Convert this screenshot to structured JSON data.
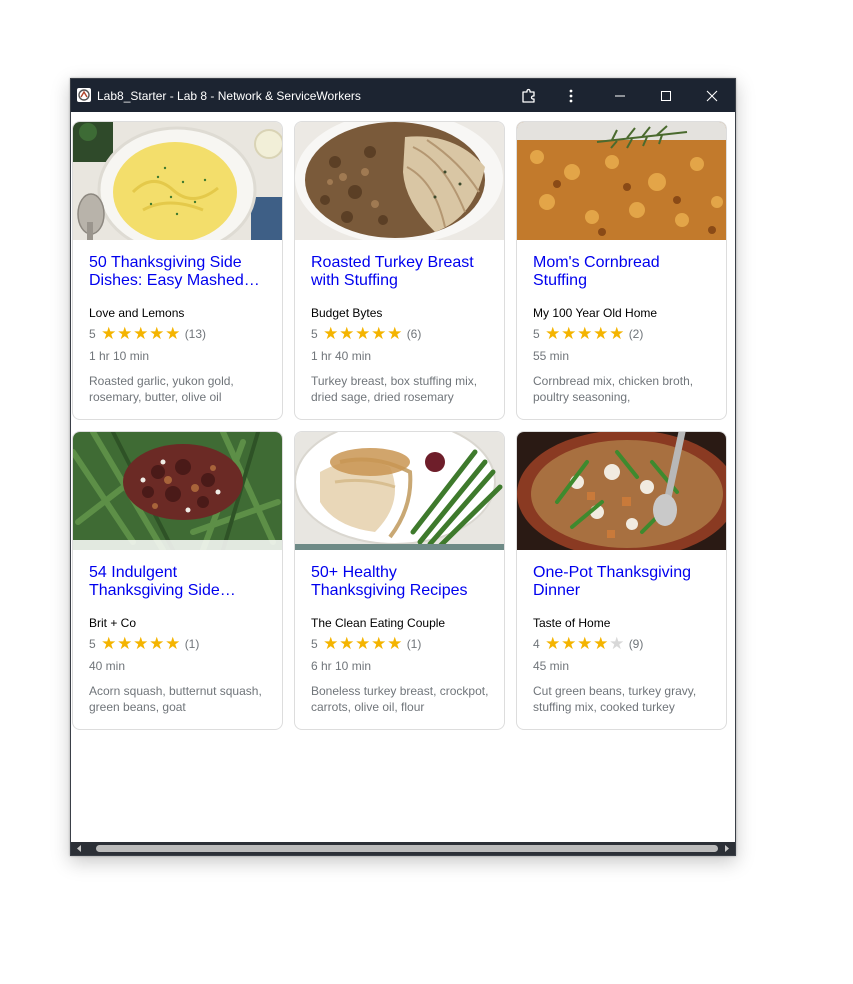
{
  "window": {
    "title": "Lab8_Starter - Lab 8 - Network & ServiceWorkers",
    "controls": {
      "extension_icon": "puzzle-icon",
      "menu_icon": "kebab-menu-icon",
      "minimize_icon": "minimize-icon",
      "maximize_icon": "maximize-icon",
      "close_icon": "close-icon"
    },
    "titlebar_color": "#1c2431"
  },
  "recipes": [
    {
      "title_line1": "50 Thanksgiving Side",
      "title_line2": "Dishes: Easy Mashed…",
      "author": "Love and Lemons",
      "rating": "5",
      "stars": 5,
      "reviews": "(13)",
      "time": "1 hr 10 min",
      "ingredients": "Roasted garlic, yukon gold, rosemary, butter, olive oil",
      "image": "mashed-potatoes"
    },
    {
      "title_line1": "Roasted Turkey Breast",
      "title_line2": "with Stuffing",
      "author": "Budget Bytes",
      "rating": "5",
      "stars": 5,
      "reviews": "(6)",
      "time": "1 hr 40 min",
      "ingredients": "Turkey breast, box stuffing mix, dried sage, dried rosemary",
      "image": "turkey-stuffing"
    },
    {
      "title_line1": "Mom's Cornbread",
      "title_line2": "Stuffing",
      "author": "My 100 Year Old Home",
      "rating": "5",
      "stars": 5,
      "reviews": "(2)",
      "time": "55 min",
      "ingredients": "Cornbread mix, chicken broth, poultry seasoning,",
      "image": "cornbread-stuffing"
    },
    {
      "title_line1": "54 Indulgent",
      "title_line2": "Thanksgiving Side…",
      "author": "Brit + Co",
      "rating": "5",
      "stars": 5,
      "reviews": "(1)",
      "time": "40 min",
      "ingredients": "Acorn squash, butternut squash, green beans, goat",
      "image": "green-beans-pecans"
    },
    {
      "title_line1": "50+ Healthy",
      "title_line2": "Thanksgiving Recipes",
      "author": "The Clean Eating Couple",
      "rating": "5",
      "stars": 5,
      "reviews": "(1)",
      "time": "6 hr 10 min",
      "ingredients": "Boneless turkey breast, crockpot, carrots, olive oil, flour",
      "image": "turkey-plate"
    },
    {
      "title_line1": "One-Pot Thanksgiving",
      "title_line2": "Dinner",
      "author": "Taste of Home",
      "rating": "4",
      "stars": 4,
      "reviews": "(9)",
      "time": "45 min",
      "ingredients": "Cut green beans, turkey gravy, stuffing mix, cooked turkey",
      "image": "one-pot-dinner"
    }
  ],
  "colors": {
    "link": "#0000ee",
    "star": "#f4b400",
    "muted": "#70757a"
  }
}
